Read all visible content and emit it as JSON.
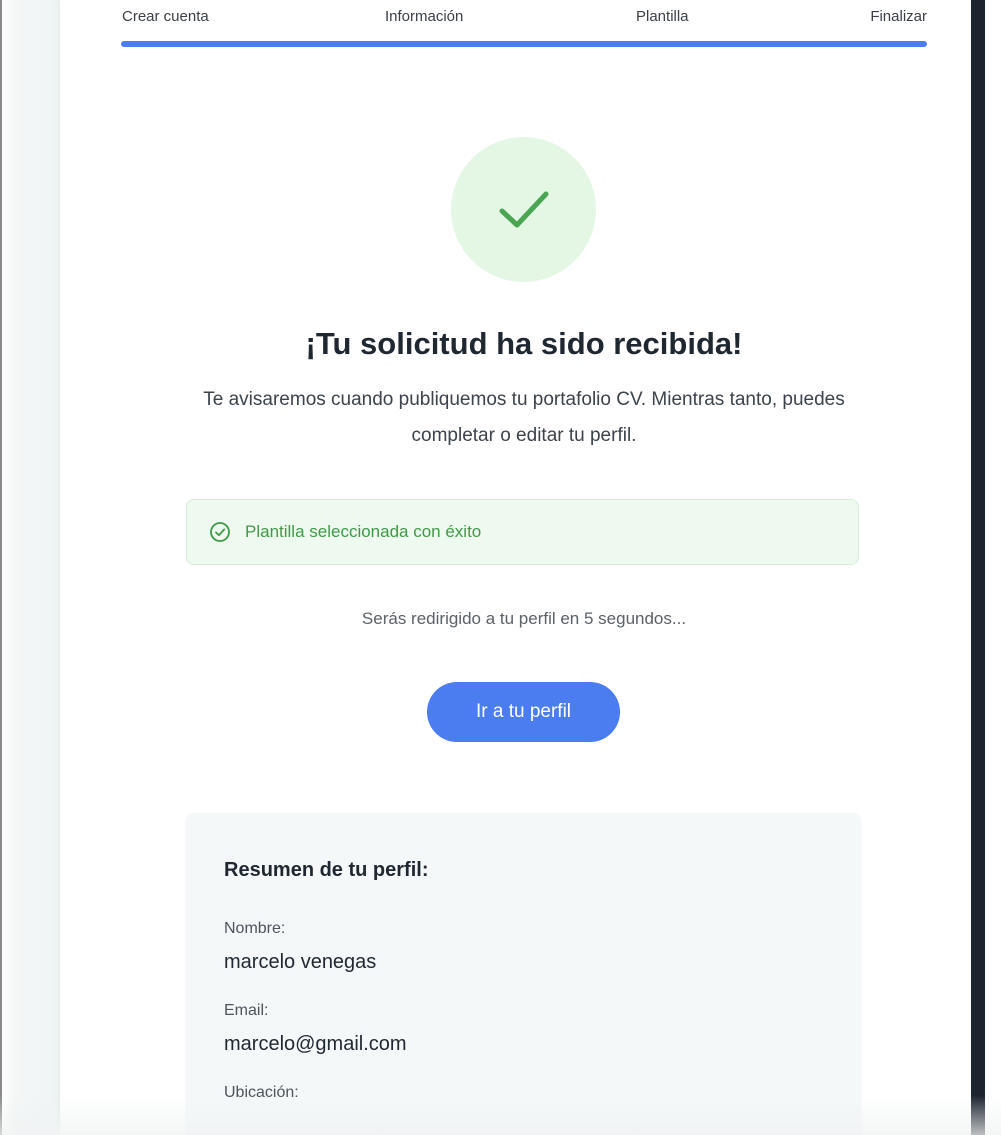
{
  "steps": {
    "items": [
      {
        "label": "Crear cuenta"
      },
      {
        "label": "Información"
      },
      {
        "label": "Plantilla"
      },
      {
        "label": "Finalizar"
      }
    ],
    "progress_percent": 100,
    "progress_color": "#4c7df0"
  },
  "success": {
    "icon": "checkmark-icon",
    "circle_color": "#e3f7e4",
    "check_color": "#4aa652"
  },
  "confirmation": {
    "title": "¡Tu solicitud ha sido recibida!",
    "message": "Te avisaremos cuando publiquemos tu portafolio CV. Mientras tanto, puedes completar o editar tu perfil."
  },
  "alert": {
    "icon": "check-circle-icon",
    "text": "Plantilla seleccionada con éxito",
    "color": "#3f9a47"
  },
  "redirect": {
    "text": "Serás redirigido a tu perfil en 5 segundos..."
  },
  "cta": {
    "label": "Ir a tu perfil"
  },
  "summary": {
    "title": "Resumen de tu perfil:",
    "fields": [
      {
        "label": "Nombre:",
        "value": "marcelo venegas"
      },
      {
        "label": "Email:",
        "value": "marcelo@gmail.com"
      },
      {
        "label": "Ubicación:",
        "value": ""
      }
    ]
  }
}
